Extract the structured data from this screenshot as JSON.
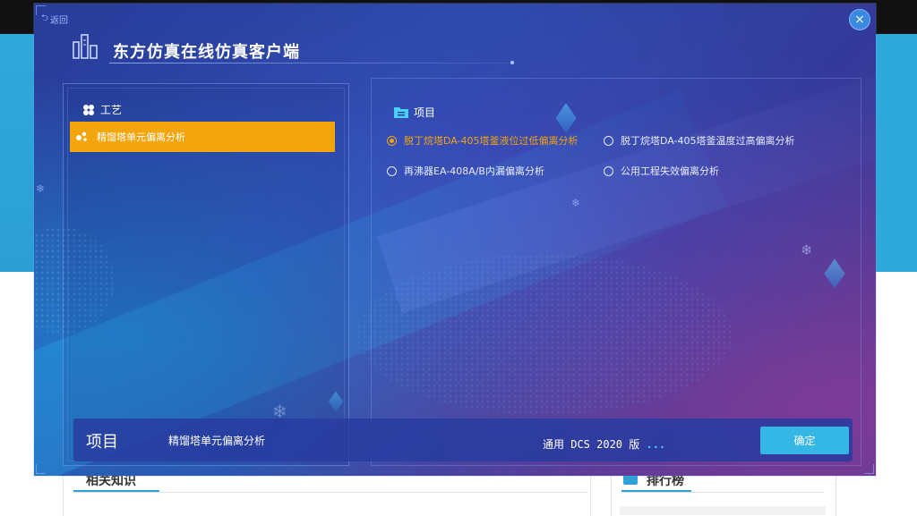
{
  "background_page": {
    "related_heading": "相关知识",
    "ranking_heading": "排行榜"
  },
  "dialog": {
    "back_label": "返回",
    "close_label": "×",
    "title": "东方仿真在线仿真客户端",
    "process_section": {
      "heading": "工艺",
      "items": [
        {
          "label": "精馏塔单元偏离分析",
          "selected": true
        }
      ]
    },
    "project_section": {
      "heading": "项目",
      "options": [
        {
          "label": "脱丁烷塔DA-405塔釜液位过低偏离分析",
          "selected": true
        },
        {
          "label": "脱丁烷塔DA-405塔釜温度过高偏离分析",
          "selected": false
        },
        {
          "label": "再沸器EA-408A/B内漏偏离分析",
          "selected": false
        },
        {
          "label": "公用工程失效偏离分析",
          "selected": false
        }
      ]
    },
    "footer": {
      "label": "项目",
      "value": "精馏塔单元偏离分析",
      "version": "通用 DCS 2020 版",
      "version_suffix": "...",
      "confirm_label": "确定"
    },
    "colors": {
      "accent_orange": "#f2a50d",
      "confirm_blue": "#35b7e6"
    }
  }
}
